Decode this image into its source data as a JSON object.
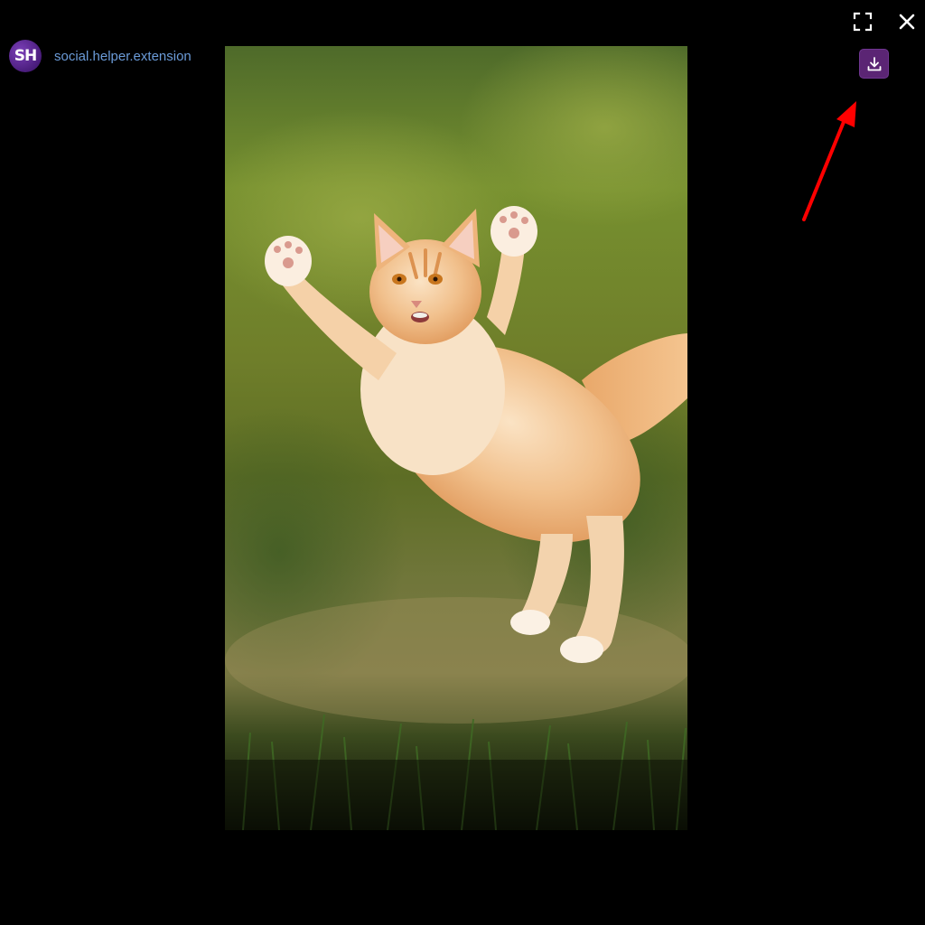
{
  "header": {
    "avatar_initials": "SH",
    "username": "social.helper.extension"
  },
  "controls": {
    "fullscreen_icon": "fullscreen-icon",
    "close_icon": "close-icon",
    "download_icon": "download-icon"
  },
  "media": {
    "subject": "orange-cat-photo"
  },
  "colors": {
    "background": "#000000",
    "username": "#6b9bd8",
    "accent": "#5b2574",
    "annotation_arrow": "#ff0000"
  }
}
